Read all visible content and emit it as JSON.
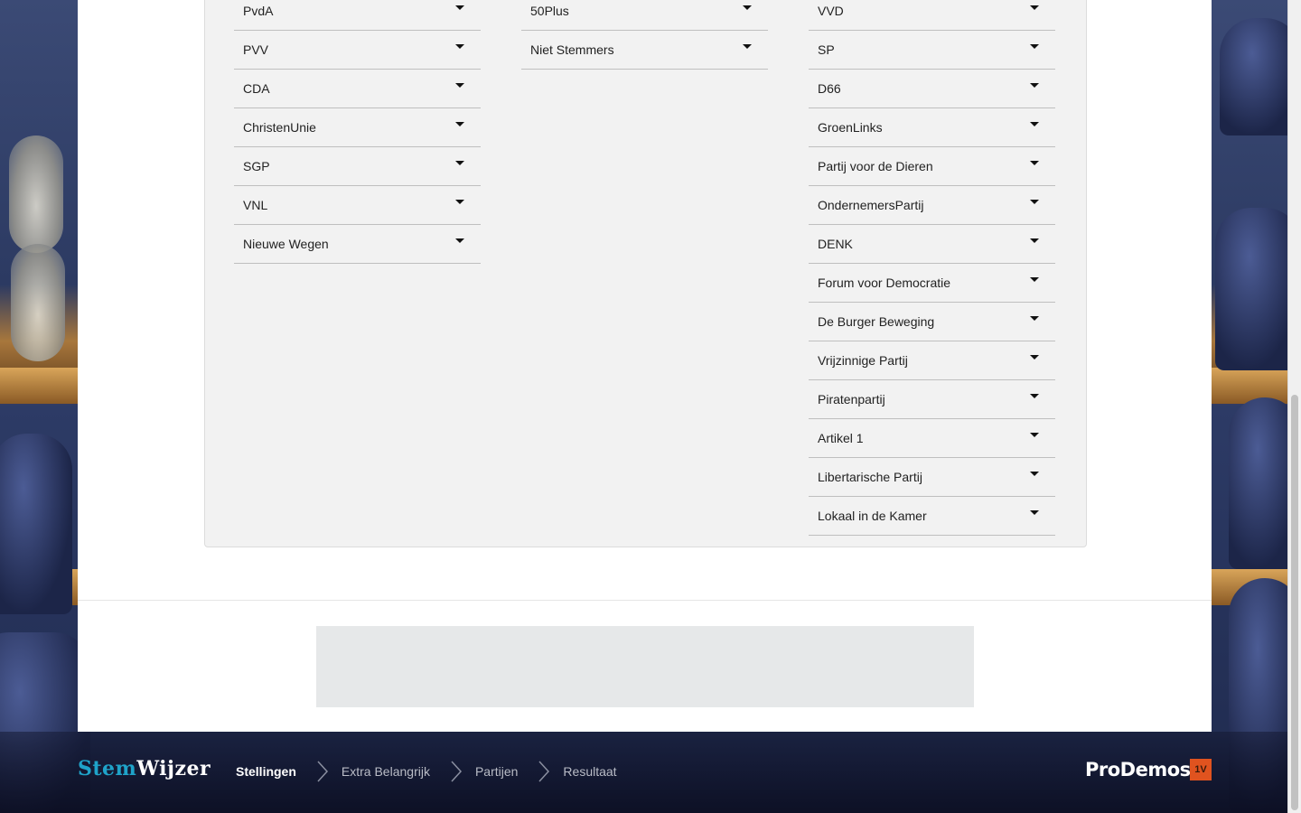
{
  "parties": {
    "col1": [
      "PvdA",
      "PVV",
      "CDA",
      "ChristenUnie",
      "SGP",
      "VNL",
      "Nieuwe Wegen"
    ],
    "col2": [
      "50Plus",
      "Niet Stemmers"
    ],
    "col3": [
      "VVD",
      "SP",
      "D66",
      "GroenLinks",
      "Partij voor de Dieren",
      "OndernemersPartij",
      "DENK",
      "Forum voor Democratie",
      "De Burger Beweging",
      "Vrijzinnige Partij",
      "Piratenpartij",
      "Artikel 1",
      "Libertarische Partij",
      "Lokaal in de Kamer"
    ]
  },
  "footer": {
    "logo_stem": "Stem",
    "logo_wijzer": "Wijzer",
    "steps": [
      "Stellingen",
      "Extra Belangrijk",
      "Partijen",
      "Resultaat"
    ],
    "prodemos": "ProDemos",
    "badge": "1V"
  },
  "colors": {
    "accent": "#1fa3c9",
    "badge": "#e0531f"
  },
  "icons": {
    "row_toggle": "caret-down-icon",
    "step_separator": "chevron-right-icon"
  }
}
